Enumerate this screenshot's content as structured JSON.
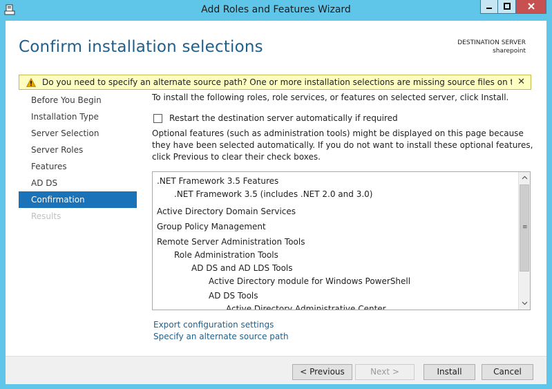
{
  "window": {
    "title": "Add Roles and Features Wizard",
    "controls": {
      "minimize": "▁",
      "maximize": "□",
      "close": "✕"
    }
  },
  "header": {
    "title": "Confirm installation selections",
    "destination_label": "DESTINATION SERVER",
    "destination_value": "sharepoint"
  },
  "warning": {
    "text": "Do you need to specify an alternate source path? One or more installation selections are missing source files on the destinati...",
    "close": "✕"
  },
  "nav": {
    "items": [
      {
        "label": "Before You Begin",
        "state": "normal"
      },
      {
        "label": "Installation Type",
        "state": "normal"
      },
      {
        "label": "Server Selection",
        "state": "normal"
      },
      {
        "label": "Server Roles",
        "state": "normal"
      },
      {
        "label": "Features",
        "state": "normal"
      },
      {
        "label": "AD DS",
        "state": "normal"
      },
      {
        "label": "Confirmation",
        "state": "active"
      },
      {
        "label": "Results",
        "state": "disabled"
      }
    ]
  },
  "content": {
    "intro": "To install the following roles, role services, or features on selected server, click Install.",
    "restart_label": "Restart the destination server automatically if required",
    "restart_checked": false,
    "optional_text": "Optional features (such as administration tools) might be displayed on this page because they have been selected automatically. If you do not want to install these optional features, click Previous to clear their check boxes.",
    "list": [
      {
        "text": ".NET Framework 3.5 Features",
        "level": 0
      },
      {
        "text": ".NET Framework 3.5 (includes .NET 2.0 and 3.0)",
        "level": 1
      },
      {
        "text": "Active Directory Domain Services",
        "level": 0
      },
      {
        "text": "Group Policy Management",
        "level": 0
      },
      {
        "text": "Remote Server Administration Tools",
        "level": 0
      },
      {
        "text": "Role Administration Tools",
        "level": 1
      },
      {
        "text": "AD DS and AD LDS Tools",
        "level": 2
      },
      {
        "text": "Active Directory module for Windows PowerShell",
        "level": 3
      },
      {
        "text": "AD DS Tools",
        "level": 3
      },
      {
        "text": "Active Directory Administrative Center",
        "level": 4
      }
    ],
    "scroll": {
      "up": "⌃",
      "down": "⌄",
      "grip": "≡"
    }
  },
  "links": {
    "export": "Export configuration settings",
    "alternate_source": "Specify an alternate source path"
  },
  "buttons": {
    "previous": "< Previous",
    "next": "Next >",
    "install": "Install",
    "cancel": "Cancel"
  },
  "colors": {
    "frame": "#5fc6ea",
    "accent": "#1a73b8",
    "title_text": "#1f5f8b",
    "warning_bg": "#fefec0"
  }
}
